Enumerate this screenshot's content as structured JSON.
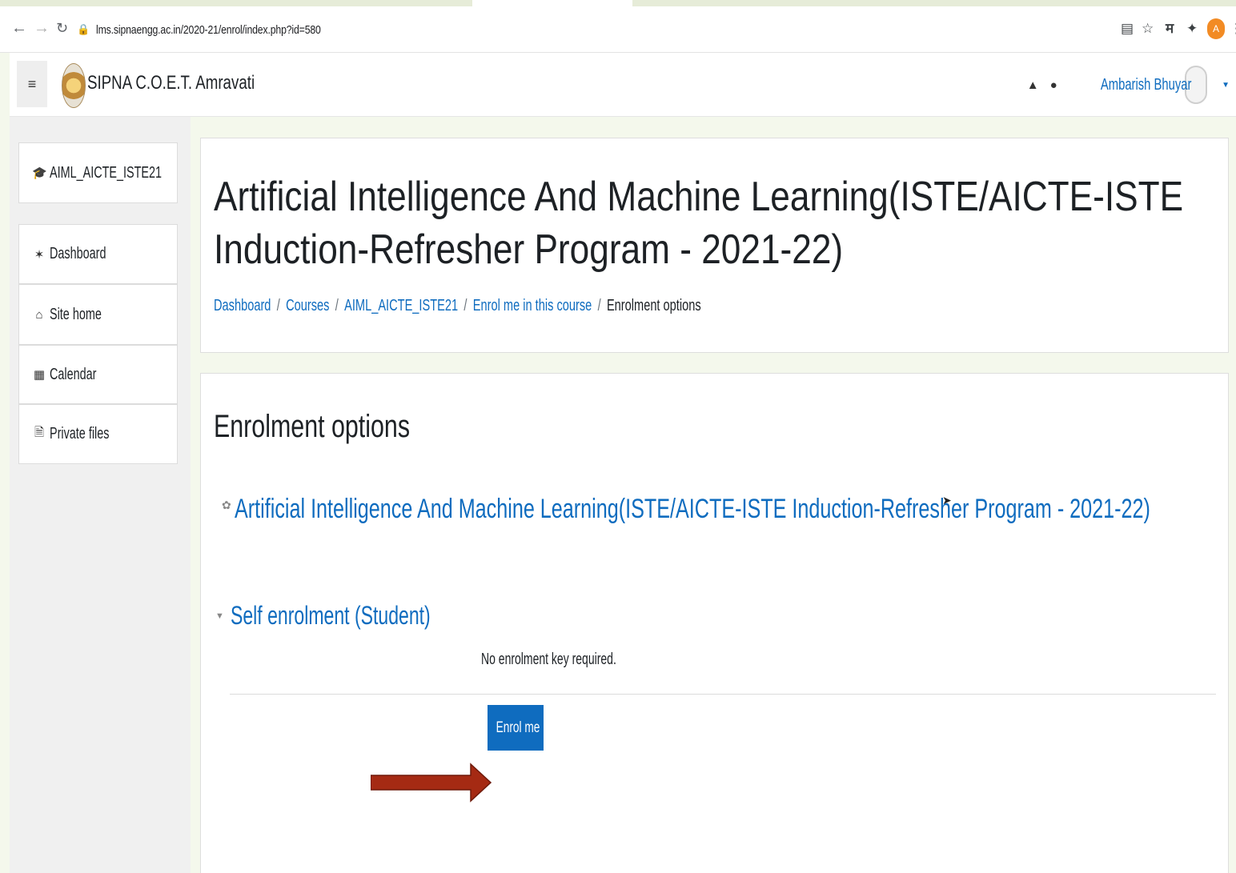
{
  "browser": {
    "url": "lms.sipnaengg.ac.in/2020-21/enrol/index.php?id=580",
    "profile_initial": "A",
    "ext_hindi": "म"
  },
  "navbar": {
    "site_name": "SIPNA C.O.E.T. Amravati",
    "user_name": "Ambarish Bhuyar"
  },
  "sidebar": {
    "items": [
      {
        "label": "AIML_AICTE_ISTE21",
        "icon": "graduation-cap-icon"
      },
      {
        "label": "Dashboard",
        "icon": "tachometer-icon"
      },
      {
        "label": "Site home",
        "icon": "home-icon"
      },
      {
        "label": "Calendar",
        "icon": "calendar-icon"
      },
      {
        "label": "Private files",
        "icon": "file-icon"
      }
    ]
  },
  "header": {
    "course_title": "Artificial Intelligence And Machine Learning(ISTE/AICTE-ISTE Induction-Refresher Program - 2021-22)",
    "breadcrumb": [
      "Dashboard",
      "Courses",
      "AIML_AICTE_ISTE21",
      "Enrol me in this course",
      "Enrolment options"
    ]
  },
  "content": {
    "heading": "Enrolment options",
    "course_link": "Artificial Intelligence And Machine Learning(ISTE/AICTE-ISTE Induction-Refresher Program - 2021-22)",
    "enrol_method": "Self enrolment (Student)",
    "no_key_text": "No enrolment key required.",
    "enrol_button": "Enrol me"
  },
  "colors": {
    "link": "#0f6cbf",
    "button": "#0f6cbf",
    "arrow": "#a52a13",
    "profile": "#f28b24"
  }
}
